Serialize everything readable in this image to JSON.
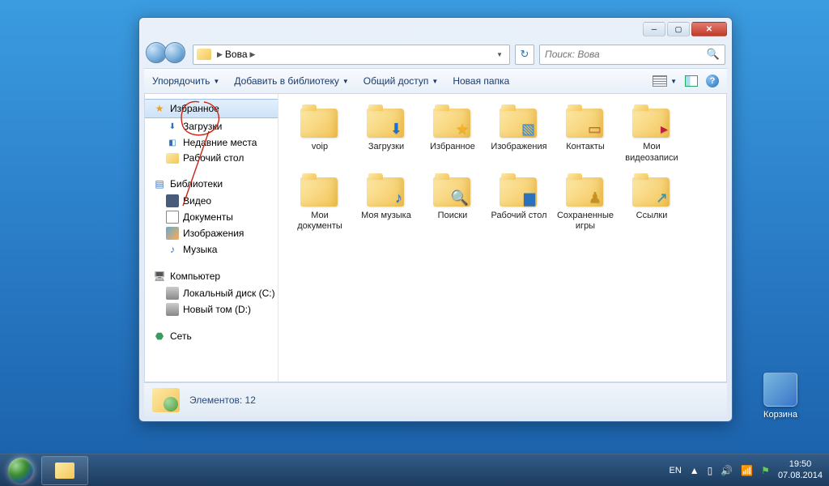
{
  "desktop": {
    "recycle_bin": "Корзина"
  },
  "taskbar": {
    "lang": "EN",
    "time": "19:50",
    "date": "07.08.2014"
  },
  "window": {
    "breadcrumb": {
      "root": "Вова"
    },
    "search_placeholder": "Поиск: Вова",
    "toolbar": {
      "organize": "Упорядочить",
      "add_library": "Добавить в библиотеку",
      "share": "Общий доступ",
      "new_folder": "Новая папка"
    },
    "sidebar": {
      "favorites": "Избранное",
      "fav_items": [
        "Загрузки",
        "Недавние места",
        "Рабочий стол"
      ],
      "libraries": "Библиотеки",
      "lib_items": [
        "Видео",
        "Документы",
        "Изображения",
        "Музыка"
      ],
      "computer": "Компьютер",
      "comp_items": [
        "Локальный диск (C:)",
        "Новый том (D:)"
      ],
      "network": "Сеть"
    },
    "items": [
      {
        "name": "voip",
        "ov": ""
      },
      {
        "name": "Загрузки",
        "ov": "⬇",
        "cls": "ov-down"
      },
      {
        "name": "Избранное",
        "ov": "★",
        "cls": "ov-star"
      },
      {
        "name": "Изображения",
        "ov": "▧",
        "cls": "ov-img"
      },
      {
        "name": "Контакты",
        "ov": "▭",
        "cls": "ov-contact"
      },
      {
        "name": "Мои видеозаписи",
        "ov": "▸",
        "cls": "ov-vid"
      },
      {
        "name": "Мои документы",
        "ov": "",
        "cls": "ov-doc"
      },
      {
        "name": "Моя музыка",
        "ov": "♪",
        "cls": "ov-mus"
      },
      {
        "name": "Поиски",
        "ov": "🔍",
        "cls": "ov-search"
      },
      {
        "name": "Рабочий стол",
        "ov": "▆",
        "cls": "ov-desk"
      },
      {
        "name": "Сохраненные игры",
        "ov": "♟",
        "cls": "ov-game"
      },
      {
        "name": "Ссылки",
        "ov": "↗",
        "cls": "ov-link"
      }
    ],
    "status": "Элементов: 12"
  }
}
